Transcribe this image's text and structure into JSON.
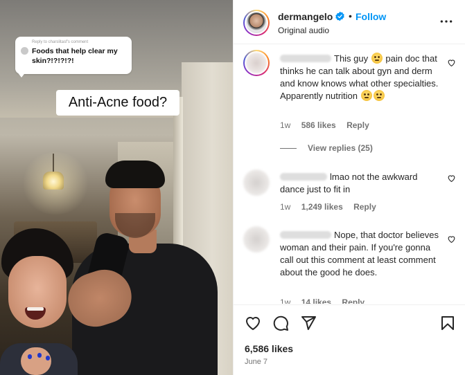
{
  "video": {
    "sticker": {
      "reply_to": "Reply to charslitasf's comment",
      "text": "Foods that help clear my skin?!?!?!?!"
    },
    "caption": "Anti-Acne food?"
  },
  "post": {
    "username": "dermangelo",
    "follow_label": "Follow",
    "separator": "•",
    "audio": "Original audio"
  },
  "comments": [
    {
      "text": "This guy 🙄 pain doc that thinks he can talk about gyn and derm and know knows what other specialties. Apparently nutrition 🙄🙄",
      "text_part1": "This guy",
      "text_part2": "pain doc that thinks he can talk about gyn and derm and know knows what other specialties. Apparently nutrition",
      "time": "1w",
      "likes": "586 likes",
      "reply_label": "Reply",
      "view_replies": "View replies (25)"
    },
    {
      "text": "lmao not the awkward dance just to fit in",
      "time": "1w",
      "likes": "1,249 likes",
      "reply_label": "Reply"
    },
    {
      "text": "Nope, that doctor believes woman and their pain. If you're gonna call out this comment at least comment about the good he does.",
      "time": "1w",
      "likes": "14 likes",
      "reply_label": "Reply"
    }
  ],
  "footer": {
    "likes": "6,586 likes",
    "date": "June 7"
  },
  "icons": {
    "like": "heart-icon",
    "comment": "comment-icon",
    "share": "send-icon",
    "save": "bookmark-icon",
    "more": "more-options-icon",
    "verified": "verified-badge-icon"
  },
  "colors": {
    "accent": "#0095f6",
    "text": "#262626",
    "muted": "#737373"
  }
}
